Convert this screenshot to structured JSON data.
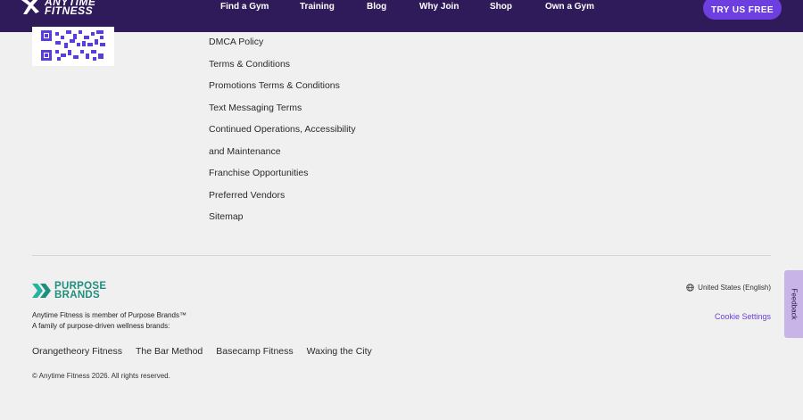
{
  "header": {
    "logo_text": "ANYTIME\nFITNESS",
    "nav": [
      "Find a Gym",
      "Training",
      "Blog",
      "Why Join",
      "Shop",
      "Own a Gym"
    ],
    "cta_label": "TRY US FREE"
  },
  "legal_links": [
    "DMCA Policy",
    "Terms & Conditions",
    "Promotions Terms & Conditions",
    "Text Messaging Terms",
    "Continued Operations, Accessibility",
    "and Maintenance",
    "Franchise Opportunities",
    "Preferred Vendors",
    "Sitemap"
  ],
  "purpose_brands": {
    "logo_line1": "PURPOSE",
    "logo_line2": "BRANDS",
    "member_text": "Anytime Fitness is member of Purpose Brands™",
    "family_text": "A family of purpose-driven wellness brands:",
    "brands": [
      "Orangetheory Fitness",
      "The Bar Method",
      "Basecamp Fitness",
      "Waxing the City"
    ],
    "brand_color": "#1f8f7d"
  },
  "footer": {
    "copyright": "© Anytime Fitness 2026. All rights reserved.",
    "region": "United States (English)",
    "cookie_settings": "Cookie Settings"
  },
  "feedback_label": "Feedback",
  "icons": {
    "region": "globe-icon",
    "qr": "qr-code-icon"
  },
  "colors": {
    "nav_bg": "#2f1a5a",
    "accent": "#6d3fe0",
    "page_bg": "#f1f0f0"
  }
}
